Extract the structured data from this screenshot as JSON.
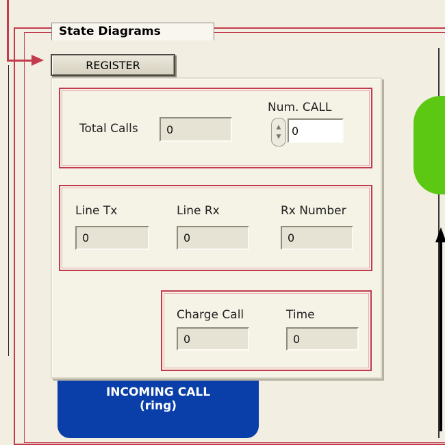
{
  "tab": {
    "label": "State Diagrams"
  },
  "register_button": {
    "label": "REGISTER"
  },
  "counters": {
    "total_calls": {
      "label": "Total Calls",
      "value": "0"
    },
    "num_call": {
      "label": "Num. CALL",
      "value": "0"
    }
  },
  "line": {
    "tx": {
      "label": "Line Tx",
      "value": "0"
    },
    "rx": {
      "label": "Line Rx",
      "value": "0"
    },
    "rx_number": {
      "label": "Rx Number",
      "value": "0"
    }
  },
  "charge": {
    "charge_call": {
      "label": "Charge Call",
      "value": "0"
    },
    "time": {
      "label": "Time",
      "value": "0"
    }
  },
  "states": {
    "incoming": {
      "line1": "INCOMING CALL",
      "line2": "(ring)",
      "color": "#0a3ea8"
    },
    "green_state_color": "#5dc814"
  },
  "colors": {
    "frame": "#c23b4d",
    "background": "#f2eee2"
  }
}
